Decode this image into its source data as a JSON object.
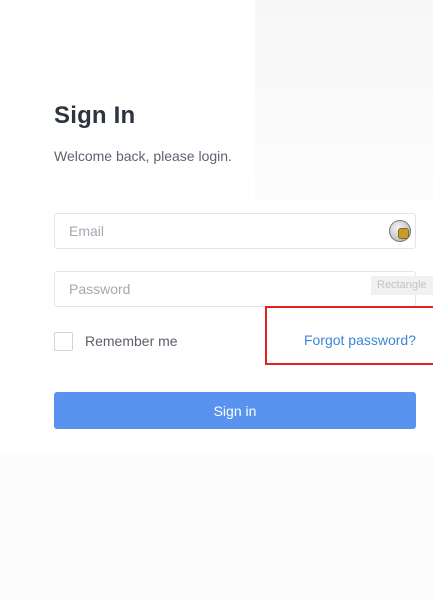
{
  "header": {
    "title": "Sign In",
    "subtitle": "Welcome back, please login."
  },
  "form": {
    "email": {
      "placeholder": "Email",
      "value": ""
    },
    "password": {
      "placeholder": "Password",
      "value": ""
    },
    "autofill_hint": "Rectangle",
    "remember_label": "Remember me",
    "remember_checked": false,
    "forgot_link": "Forgot password?",
    "submit_label": "Sign in"
  },
  "icons": {
    "email_field_icon": "keychain-icon"
  },
  "colors": {
    "primary_button": "#5a93ef",
    "link": "#3c86d4",
    "highlight": "#e02222",
    "title": "#2c3440"
  }
}
